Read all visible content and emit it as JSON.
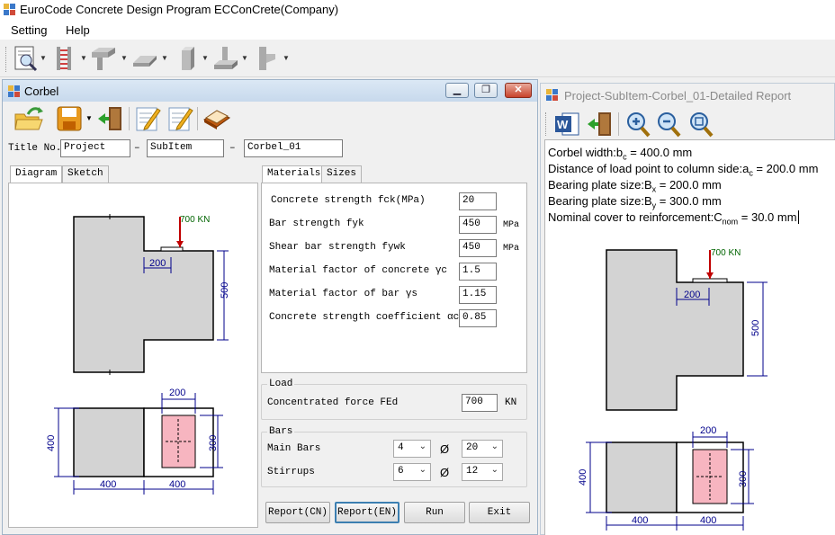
{
  "app": {
    "title": "EuroCode Concrete Design Program ECConCrete(Company)",
    "menu": [
      "Setting",
      "Help"
    ]
  },
  "corbel_window": {
    "title": "Corbel",
    "title_no_label": "Title No.",
    "title_fields": [
      "Project",
      "SubItem",
      "Corbel_01"
    ],
    "separator": "–",
    "left_tabs": [
      "Diagram",
      "Sketch"
    ],
    "right_tabs": [
      "Materials",
      "Sizes"
    ],
    "materials": [
      {
        "label": "Concrete strength fck(MPa)",
        "value": "20",
        "unit": ""
      },
      {
        "label": "Bar strength fyk",
        "value": "450",
        "unit": "MPa"
      },
      {
        "label": "Shear bar strength fywk",
        "value": "450",
        "unit": "MPa"
      },
      {
        "label": "Material factor of concrete γc",
        "value": "1.5",
        "unit": ""
      },
      {
        "label": "Material factor of bar γs",
        "value": "1.15",
        "unit": ""
      },
      {
        "label": "Concrete strength coefficient αcc",
        "value": "0.85",
        "unit": ""
      }
    ],
    "load_group": "Load",
    "load_label": "Concentrated force FEd",
    "load_value": "700",
    "load_unit": "KN",
    "bars_group": "Bars",
    "main_bars_label": "Main Bars",
    "main_bars_count": "4",
    "main_bars_dia": "20",
    "stirrups_label": "Stirrups",
    "stirrups_count": "6",
    "stirrups_dia": "12",
    "dia_symbol": "Ø",
    "buttons": [
      "Report(CN)",
      "Report(EN)",
      "Run",
      "Exit"
    ],
    "diagram": {
      "load_label": "700 KN",
      "dim_200_top": "200",
      "dim_500": "500",
      "dim_200_plan": "200",
      "dim_400_left": "400",
      "dim_300": "300",
      "dim_400_bottom_a": "400",
      "dim_400_bottom_b": "400"
    }
  },
  "report_window": {
    "title": "Project-SubItem-Corbel_01-Detailed Report",
    "lines": [
      {
        "pre": "Corbel width:b",
        "sub": "c",
        "post": " = 400.0 mm"
      },
      {
        "pre": "Distance of load point to column side:a",
        "sub": "c",
        "post": " = 200.0 mm"
      },
      {
        "pre": "Bearing plate size:B",
        "sub": "x",
        "post": " = 200.0 mm"
      },
      {
        "pre": "Bearing plate size:B",
        "sub": "y",
        "post": " = 300.0 mm"
      },
      {
        "pre": "Nominal cover to reinforcement:C",
        "sub": "nom",
        "post": " = 30.0 mm"
      }
    ],
    "diagram": {
      "load_label": "700 KN",
      "dim_200_top": "200",
      "dim_500": "500",
      "dim_200_plan": "200",
      "dim_400_left": "400",
      "dim_300": "300",
      "dim_400_bottom_a": "400",
      "dim_400_bottom_b": "400"
    }
  },
  "colors": {
    "concrete_fill": "#d3d3d3",
    "load_arrow": "#c00000",
    "dimension": "#00008b",
    "plate_fill": "#f7b5c0"
  },
  "icons": {
    "main_toolbar": [
      "report-preview-icon",
      "column-ladder-icon",
      "beam-section-icon",
      "slab-icon",
      "column-icon",
      "footing-icon",
      "corbel-icon"
    ],
    "corbel_toolbar": [
      "open-folder-icon",
      "save-icon",
      "exit-door-icon",
      "edit-note-icon",
      "edit-note-2-icon",
      "book-icon"
    ],
    "report_toolbar": [
      "word-export-icon",
      "exit-door-icon",
      "zoom-in-icon",
      "zoom-out-icon",
      "zoom-fit-icon"
    ]
  }
}
